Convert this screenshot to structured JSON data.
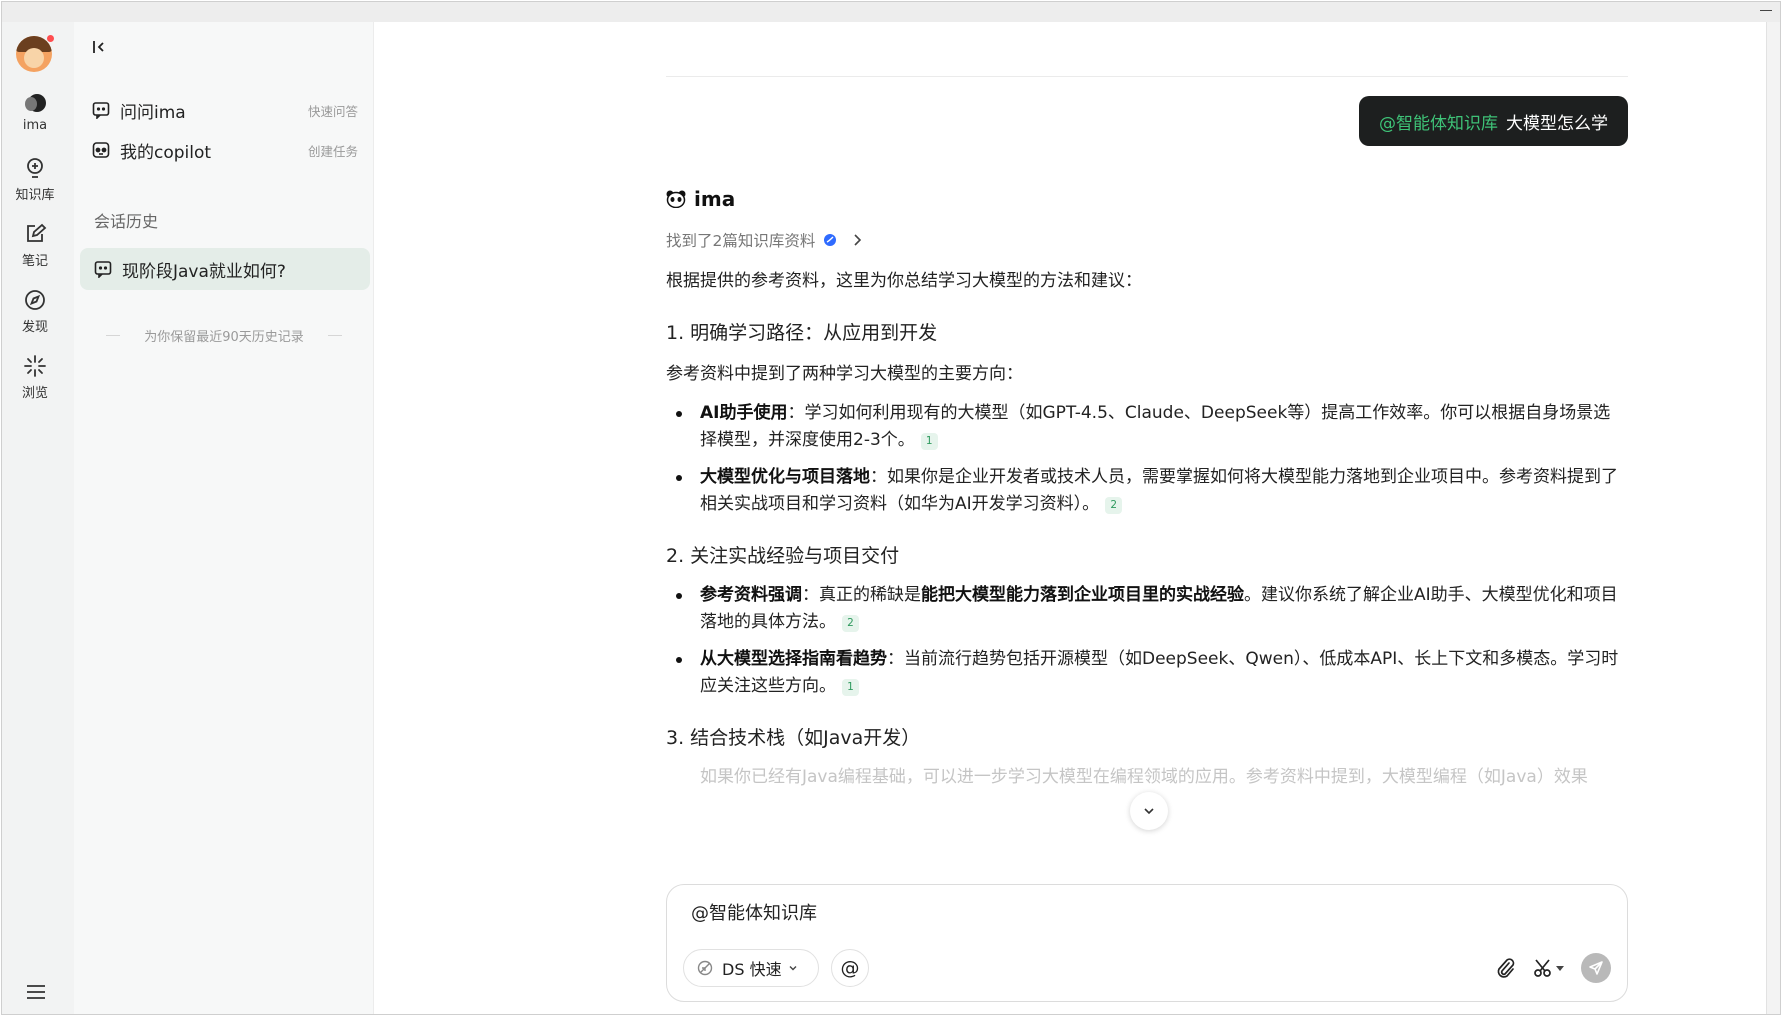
{
  "rail": {
    "items": [
      {
        "label": "ima",
        "icon": "ima-logo-icon"
      },
      {
        "label": "知识库",
        "icon": "knowledge-base-icon"
      },
      {
        "label": "笔记",
        "icon": "note-icon"
      },
      {
        "label": "发现",
        "icon": "compass-icon"
      },
      {
        "label": "浏览",
        "icon": "sparkle-icon"
      }
    ]
  },
  "sidebar": {
    "nav": [
      {
        "label": "问问ima",
        "hint": "快速问答"
      },
      {
        "label": "我的copilot",
        "hint": "创建任务"
      }
    ],
    "history_title": "会话历史",
    "history_items": [
      {
        "label": "现阶段Java就业如何?"
      }
    ],
    "keep_note": "为你保留最近90天历史记录"
  },
  "chat": {
    "user_message": {
      "mention": "@智能体知识库",
      "query": "大模型怎么学"
    },
    "assistant_name": "ima",
    "found": "找到了2篇知识库资料",
    "intro": "根据提供的参考资料，这里为你总结学习大模型的方法和建议：",
    "sections": [
      {
        "heading": "1. 明确学习路径：从应用到开发",
        "lead": "参考资料中提到了两种学习大模型的主要方向：",
        "bullets": [
          {
            "bold": "AI助手使用",
            "text": "：学习如何利用现有的大模型（如GPT-4.5、Claude、DeepSeek等）提高工作效率。你可以根据自身场景选择模型，并深度使用2-3个。",
            "cite": "1"
          },
          {
            "bold": "大模型优化与项目落地",
            "text": "：如果你是企业开发者或技术人员，需要掌握如何将大模型能力落地到企业项目中。参考资料提到了相关实战项目和学习资料（如华为AI开发学习资料）。",
            "cite": "2"
          }
        ]
      },
      {
        "heading": "2. 关注实战经验与项目交付",
        "bullets": [
          {
            "bold": "参考资料强调",
            "text_a": "：真正的稀缺是",
            "bold2": "能把大模型能力落到企业项目里的实战经验",
            "text_b": "。建议你系统了解企业AI助手、大模型优化和项目落地的具体方法。",
            "cite": "2"
          },
          {
            "bold": "从大模型选择指南看趋势",
            "text": "：当前流行趋势包括开源模型（如DeepSeek、Qwen）、低成本API、长上下文和多模态。学习时应关注这些方向。",
            "cite": "1"
          }
        ]
      },
      {
        "heading": "3. 结合技术栈（如Java开发）",
        "fade": "如果你已经有Java编程基础，可以进一步学习大模型在编程领域的应用。参考资料中提到，大模型编程（如Java）效果"
      }
    ]
  },
  "composer": {
    "value": "@智能体知识库",
    "model": "DS 快速",
    "at": "@"
  },
  "colors": {
    "accent_green": "#3ec277",
    "bubble_bg": "#1d1f1f",
    "history_active_bg": "#e4ede8"
  }
}
